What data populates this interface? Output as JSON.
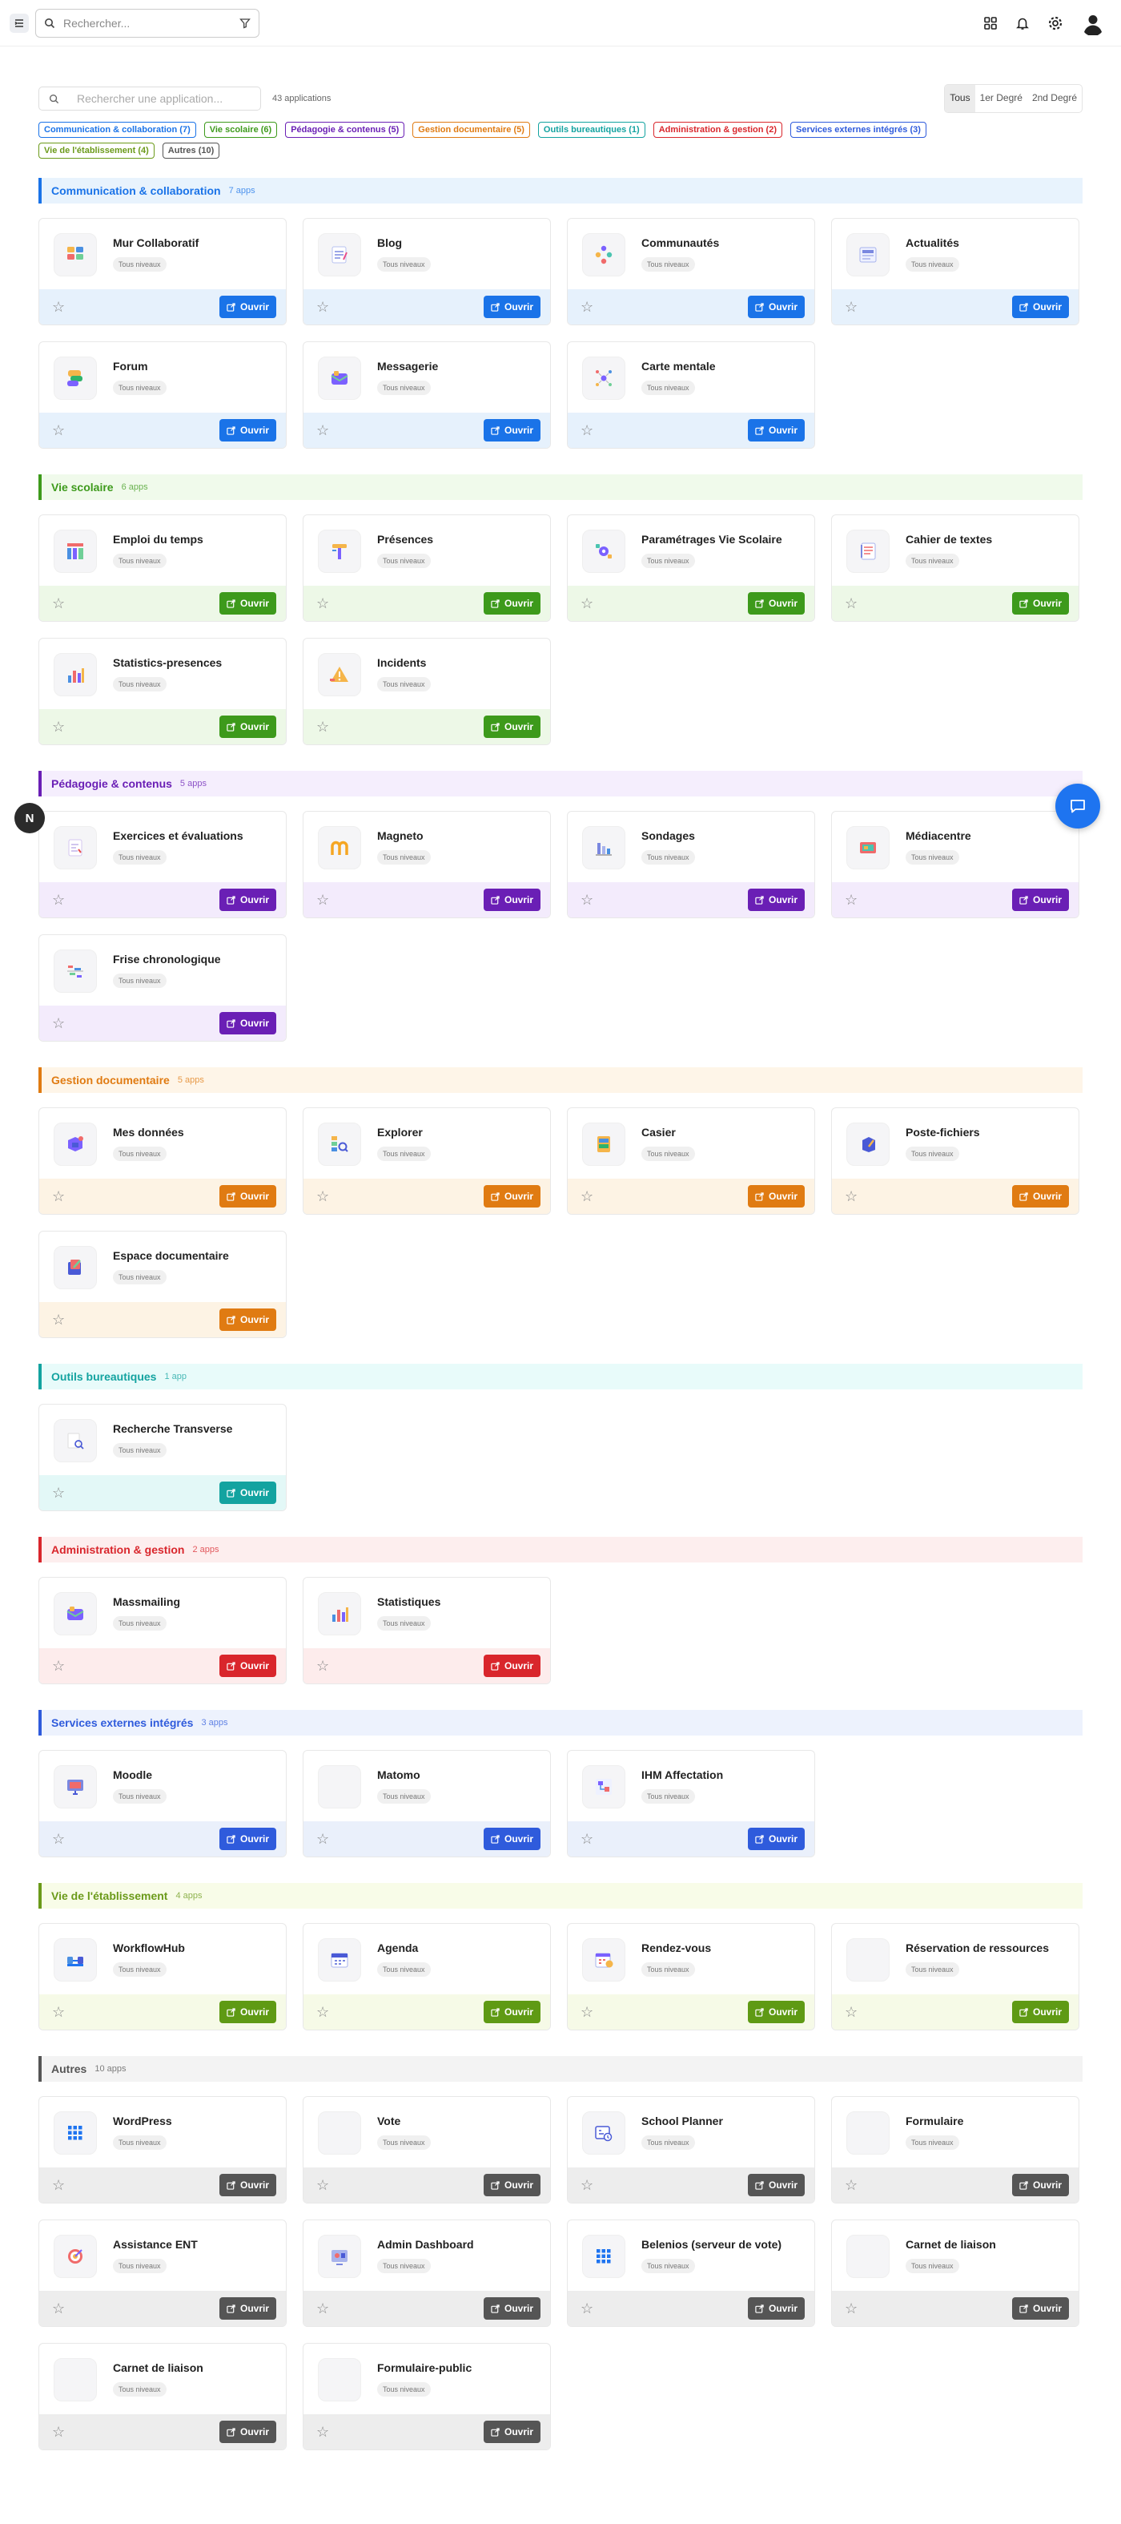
{
  "header": {
    "search_placeholder": "Rechercher..."
  },
  "toolbar": {
    "search_placeholder": "Rechercher une application...",
    "count": "43 applications",
    "levels": [
      "Tous",
      "1er Degré",
      "2nd Degré"
    ]
  },
  "filters": [
    {
      "label": "Communication & collaboration (7)",
      "color": "#1a73e8"
    },
    {
      "label": "Vie scolaire (6)",
      "color": "#3d9a1b"
    },
    {
      "label": "Pédagogie & contenus (5)",
      "color": "#6a1fb5"
    },
    {
      "label": "Gestion documentaire (5)",
      "color": "#e07b12"
    },
    {
      "label": "Outils bureautiques (1)",
      "color": "#13a3a0"
    },
    {
      "label": "Administration & gestion (2)",
      "color": "#d9262c"
    },
    {
      "label": "Services externes intégrés (3)",
      "color": "#2f5bdc"
    },
    {
      "label": "Vie de l'établissement (4)",
      "color": "#6b9a1a"
    },
    {
      "label": "Autres (10)",
      "color": "#555555"
    }
  ],
  "common": {
    "badge": "Tous niveaux",
    "open": "Ouvrir"
  },
  "categories": [
    {
      "title": "Communication & collaboration",
      "count": "7 apps",
      "color": "#1a73e8",
      "bar": "#e6f1fc",
      "head": "#e8f3fd",
      "btn": "#1a73e8",
      "apps": [
        {
          "name": "Mur Collaboratif",
          "icon": "wall"
        },
        {
          "name": "Blog",
          "icon": "blog"
        },
        {
          "name": "Communautés",
          "icon": "community"
        },
        {
          "name": "Actualités",
          "icon": "news"
        },
        {
          "name": "Forum",
          "icon": "forum"
        },
        {
          "name": "Messagerie",
          "icon": "mail"
        },
        {
          "name": "Carte mentale",
          "icon": "mindmap"
        }
      ]
    },
    {
      "title": "Vie scolaire",
      "count": "6 apps",
      "color": "#3d9a1b",
      "bar": "#edf8e7",
      "head": "#f0faeb",
      "btn": "#3d9a1b",
      "apps": [
        {
          "name": "Emploi du temps",
          "icon": "timetable"
        },
        {
          "name": "Présences",
          "icon": "presence"
        },
        {
          "name": "Paramétrages Vie Scolaire",
          "icon": "settings"
        },
        {
          "name": "Cahier de textes",
          "icon": "notebook"
        },
        {
          "name": "Statistics-presences",
          "icon": "stats"
        },
        {
          "name": "Incidents",
          "icon": "incident"
        }
      ]
    },
    {
      "title": "Pédagogie & contenus",
      "count": "5 apps",
      "color": "#6a1fb5",
      "bar": "#f3ebfc",
      "head": "#f5eefd",
      "btn": "#6a1fb5",
      "apps": [
        {
          "name": "Exercices et évaluations",
          "icon": "exercise"
        },
        {
          "name": "Magneto",
          "icon": "magneto"
        },
        {
          "name": "Sondages",
          "icon": "poll"
        },
        {
          "name": "Médiacentre",
          "icon": "media"
        },
        {
          "name": "Frise chronologique",
          "icon": "timeline"
        }
      ]
    },
    {
      "title": "Gestion documentaire",
      "count": "5 apps",
      "color": "#e07b12",
      "bar": "#fdf3e4",
      "head": "#fef5e8",
      "btn": "#e07b12",
      "apps": [
        {
          "name": "Mes données",
          "icon": "data"
        },
        {
          "name": "Explorer",
          "icon": "explorer"
        },
        {
          "name": "Casier",
          "icon": "locker"
        },
        {
          "name": "Poste-fichiers",
          "icon": "upload"
        },
        {
          "name": "Espace documentaire",
          "icon": "docs"
        }
      ]
    },
    {
      "title": "Outils bureautiques",
      "count": "1 app",
      "color": "#13a3a0",
      "bar": "#e3f8f7",
      "head": "#e8fbfa",
      "btn": "#13a3a0",
      "apps": [
        {
          "name": "Recherche Transverse",
          "icon": "search"
        }
      ]
    },
    {
      "title": "Administration & gestion",
      "count": "2 apps",
      "color": "#d9262c",
      "bar": "#fdecec",
      "head": "#fdeeee",
      "btn": "#d9262c",
      "apps": [
        {
          "name": "Massmailing",
          "icon": "mail"
        },
        {
          "name": "Statistiques",
          "icon": "stats"
        }
      ]
    },
    {
      "title": "Services externes intégrés",
      "count": "3 apps",
      "color": "#2f5bdc",
      "bar": "#eaf0fb",
      "head": "#edf2fd",
      "btn": "#2f5bdc",
      "apps": [
        {
          "name": "Moodle",
          "icon": "moodle"
        },
        {
          "name": "Matomo",
          "icon": "blank"
        },
        {
          "name": "IHM Affectation",
          "icon": "ihm"
        }
      ]
    },
    {
      "title": "Vie de l'établissement",
      "count": "4 apps",
      "color": "#6b9a1a",
      "bar": "#f6fae7",
      "head": "#f8fce8",
      "btn": "#5f9a14",
      "apps": [
        {
          "name": "WorkflowHub",
          "icon": "workflow"
        },
        {
          "name": "Agenda",
          "icon": "agenda"
        },
        {
          "name": "Rendez-vous",
          "icon": "rdv"
        },
        {
          "name": "Réservation de ressources",
          "icon": "blank"
        }
      ]
    },
    {
      "title": "Autres",
      "count": "10 apps",
      "color": "#555555",
      "bar": "#ededed",
      "head": "#f3f3f3",
      "btn": "#555555",
      "apps": [
        {
          "name": "WordPress",
          "icon": "grid"
        },
        {
          "name": "Vote",
          "icon": "blank"
        },
        {
          "name": "School Planner",
          "icon": "planner"
        },
        {
          "name": "Formulaire",
          "icon": "blank"
        },
        {
          "name": "Assistance ENT",
          "icon": "target"
        },
        {
          "name": "Admin Dashboard",
          "icon": "admin"
        },
        {
          "name": "Belenios (serveur de vote)",
          "icon": "grid"
        },
        {
          "name": "Carnet de liaison",
          "icon": "blank"
        },
        {
          "name": "Carnet de liaison",
          "icon": "blank"
        },
        {
          "name": "Formulaire-public",
          "icon": "blank"
        }
      ]
    }
  ]
}
